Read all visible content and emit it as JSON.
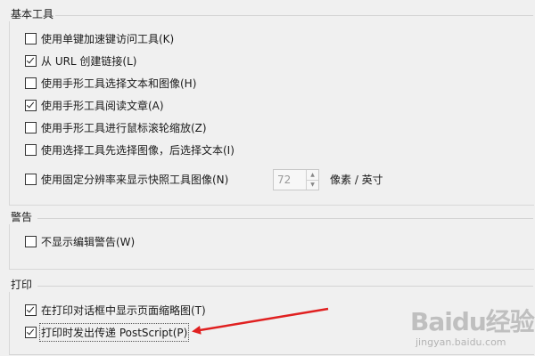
{
  "groups": {
    "basic_tools": {
      "title": "基本工具",
      "items": [
        {
          "label": "使用单键加速键访问工具(K)",
          "checked": false
        },
        {
          "label": "从 URL 创建链接(L)",
          "checked": true
        },
        {
          "label": "使用手形工具选择文本和图像(H)",
          "checked": false
        },
        {
          "label": "使用手形工具阅读文章(A)",
          "checked": true
        },
        {
          "label": "使用手形工具进行鼠标滚轮缩放(Z)",
          "checked": false
        },
        {
          "label": "使用选择工具先选择图像，后选择文本(I)",
          "checked": false
        },
        {
          "label": "使用固定分辨率来显示快照工具图像(N)",
          "checked": false
        }
      ],
      "resolution_value": "72",
      "resolution_unit": "像素 / 英寸"
    },
    "warning": {
      "title": "警告",
      "items": [
        {
          "label": "不显示编辑警告(W)",
          "checked": false
        }
      ]
    },
    "print": {
      "title": "打印",
      "items": [
        {
          "label": "在打印对话框中显示页面缩略图(T)",
          "checked": true
        },
        {
          "label": "打印时发出传递 PostScript(P)",
          "checked": true
        }
      ]
    }
  },
  "annotation": {
    "arrow_color": "#e02020"
  },
  "watermark": {
    "logo": "Baidu经验",
    "sub": "jingyan.baidu.com"
  }
}
